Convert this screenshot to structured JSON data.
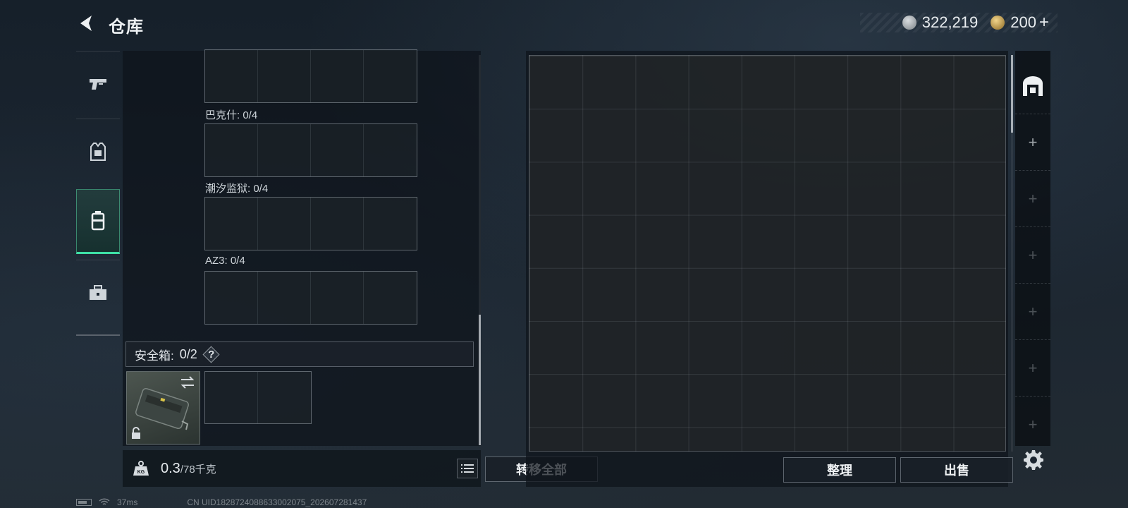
{
  "header": {
    "title": "仓库",
    "currency_primary": "322,219",
    "currency_secondary": "200",
    "currency_plus": "+"
  },
  "rail": {
    "items": [
      {
        "name": "weapon",
        "icon": "pistol-icon"
      },
      {
        "name": "armor",
        "icon": "armor-vest-icon"
      },
      {
        "name": "container",
        "icon": "backpack-icon",
        "active": true
      },
      {
        "name": "misc",
        "icon": "toolbox-icon"
      }
    ]
  },
  "left_panel": {
    "grid_labels": [
      "巴克什: 0/4",
      "潮汐监狱: 0/4",
      "AZ3: 0/4"
    ],
    "safebox_label": "安全箱:",
    "safebox_count": "0/2",
    "help": "?",
    "weight_value": "0.3",
    "weight_capacity": "/78千克",
    "transfer_all": "转移全部"
  },
  "right_panel": {
    "sort_button": "整理",
    "sell_button": "出售"
  },
  "status": {
    "ping": "37ms",
    "uid": "CN UID1828724088633002075_202607281437"
  },
  "colors": {
    "accent": "#3ee0a6",
    "panel": "#0e141a"
  }
}
